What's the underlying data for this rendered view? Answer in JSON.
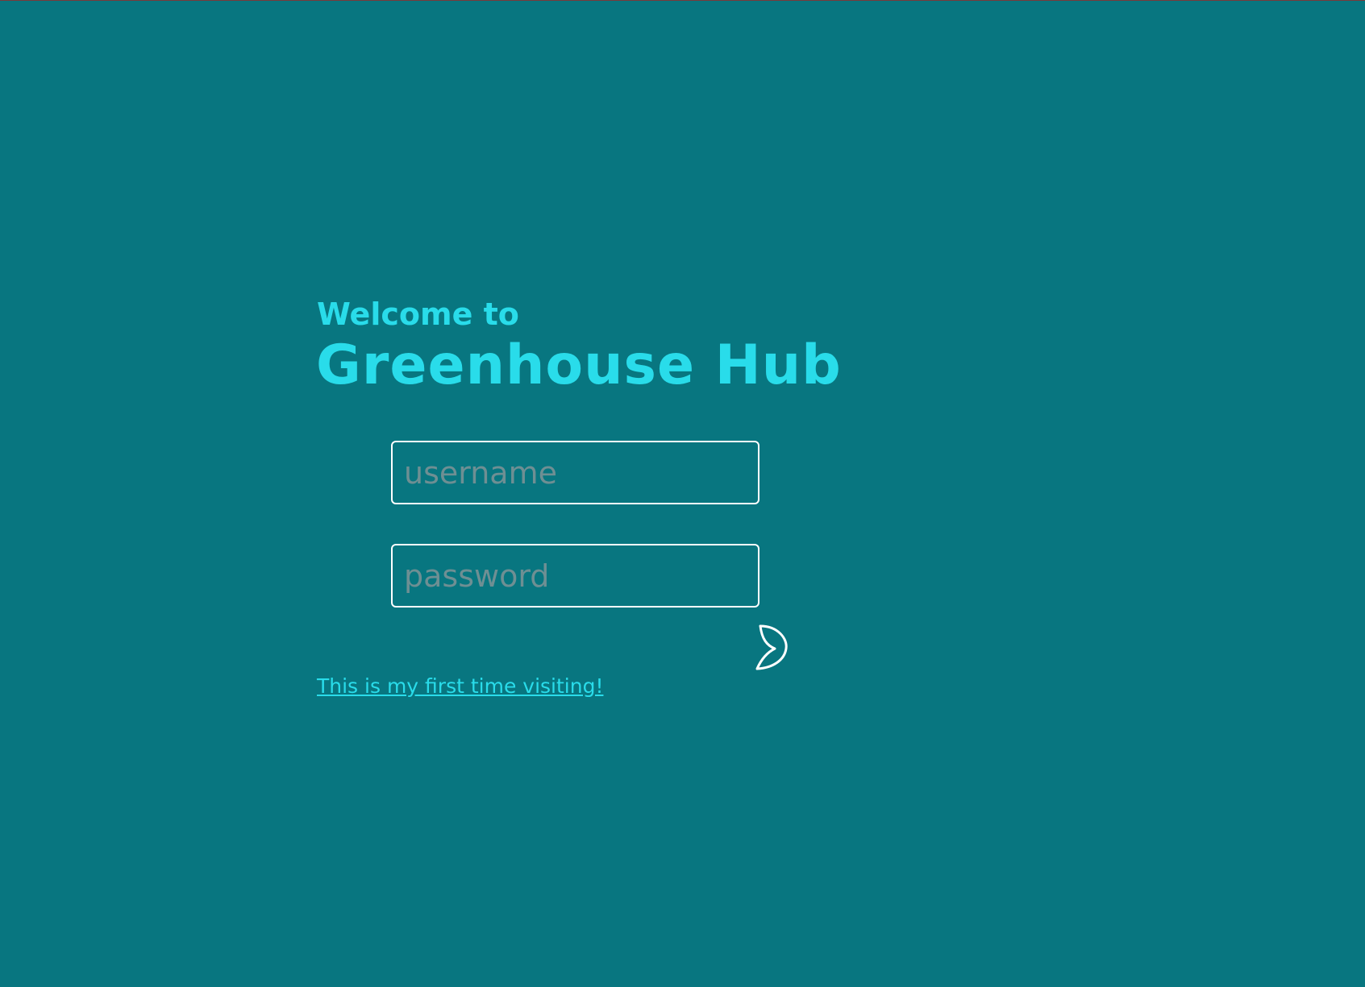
{
  "header": {
    "welcome": "Welcome to",
    "app_name": "Greenhouse Hub"
  },
  "login": {
    "username_placeholder": "username",
    "password_placeholder": "password",
    "submit_icon": "leaf-icon",
    "first_visit_link": "This is my first time visiting!"
  },
  "colors": {
    "background": "#087680",
    "accent": "#29dcea",
    "field_border": "#ffffff",
    "placeholder": "#6e8f93"
  }
}
